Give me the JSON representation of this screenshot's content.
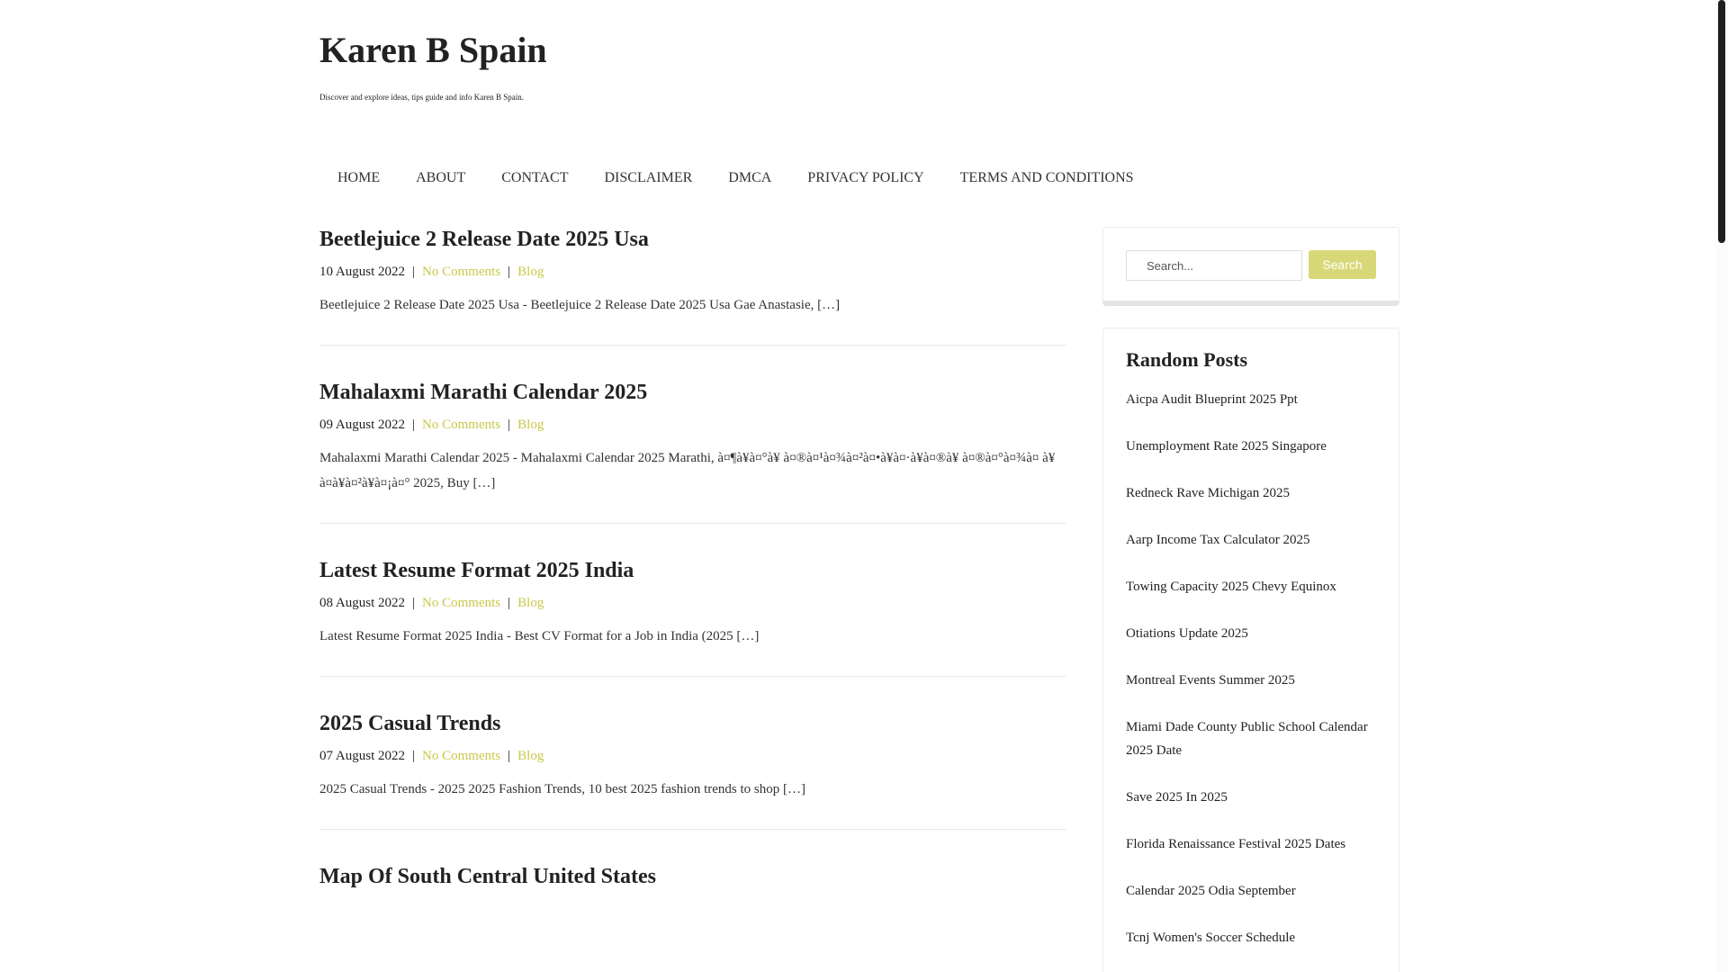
{
  "site": {
    "title": "Karen B Spain",
    "description": "Discover and explore ideas, tips guide and info Karen B Spain."
  },
  "nav": {
    "items": [
      {
        "label": "HOME"
      },
      {
        "label": "ABOUT"
      },
      {
        "label": "CONTACT"
      },
      {
        "label": "DISCLAIMER"
      },
      {
        "label": "DMCA"
      },
      {
        "label": "PRIVACY POLICY"
      },
      {
        "label": "TERMS AND CONDITIONS"
      }
    ]
  },
  "posts": [
    {
      "title": "Beetlejuice 2 Release Date 2025 Usa",
      "date": "10 August 2022",
      "comments": "No Comments",
      "category": "Blog",
      "excerpt": "Beetlejuice 2 Release Date 2025 Usa - Beetlejuice 2 Release Date 2025 Usa Gae Anastasie, […]"
    },
    {
      "title": "Mahalaxmi Marathi Calendar 2025",
      "date": "09 August 2022",
      "comments": "No Comments",
      "category": "Blog",
      "excerpt": "Mahalaxmi Marathi Calendar 2025 - Mahalaxmi Calendar 2025 Marathi, à¤¶à¥à¤°à¥ à¤®à¤¹à¤¾à¤²à¤•à¥à¤·à¥à¤®à¥ à¤®à¤°à¤¾à¤ à¥ à¤à¥à¤²à¥à¤¡à¤° 2025, Buy […]"
    },
    {
      "title": "Latest Resume Format 2025 India",
      "date": "08 August 2022",
      "comments": "No Comments",
      "category": "Blog",
      "excerpt": "Latest Resume Format 2025 India - Best CV Format for a Job in India (2025 […]"
    },
    {
      "title": "2025 Casual Trends",
      "date": "07 August 2022",
      "comments": "No Comments",
      "category": "Blog",
      "excerpt": "2025 Casual Trends - 2025 2025 Fashion Trends, 10 best 2025 fashion trends to shop […]"
    },
    {
      "title": "Map Of South Central United States",
      "date": "",
      "comments": "",
      "category": "",
      "excerpt": ""
    }
  ],
  "search": {
    "placeholder": "Search...",
    "button_label": "Search"
  },
  "random_posts": {
    "title": "Random Posts",
    "items": [
      "Aicpa Audit Blueprint 2025 Ppt",
      "Unemployment Rate 2025 Singapore",
      "Redneck Rave Michigan 2025",
      "Aarp Income Tax Calculator 2025",
      "Towing Capacity 2025 Chevy Equinox",
      "Otiations Update 2025",
      "Montreal Events Summer 2025",
      "Miami Dade County Public School Calendar 2025 Date",
      "Save 2025 In 2025",
      "Florida Renaissance Festival 2025 Dates",
      "Calendar 2025 Odia September",
      "Tcnj Women's Soccer Schedule"
    ]
  },
  "colors": {
    "link_accent": "#c8c84a",
    "button_bg": "#d8d878"
  }
}
